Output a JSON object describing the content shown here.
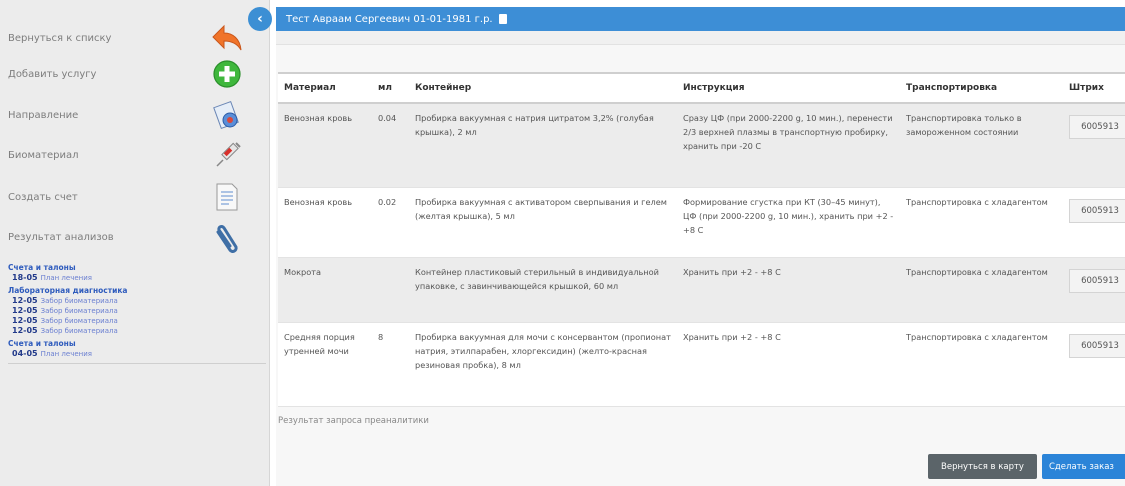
{
  "sidebar": {
    "items": [
      {
        "label": "Вернуться к списку",
        "icon": "back-arrow-icon"
      },
      {
        "label": "Добавить услугу",
        "icon": "add-plus-icon"
      },
      {
        "label": "Направление",
        "icon": "referral-icon"
      },
      {
        "label": "Биоматериал",
        "icon": "syringe-icon"
      },
      {
        "label": "Создать счет",
        "icon": "invoice-document-icon"
      },
      {
        "label": "Результат анализов",
        "icon": "paperclip-icon"
      }
    ],
    "collapse_icon": "chevron-left-icon",
    "links": [
      {
        "title": "Счета и талоны",
        "entries": [
          {
            "date": "18-05",
            "text": "План лечения"
          }
        ]
      },
      {
        "title": "Лабораторная диагностика",
        "entries": [
          {
            "date": "12-05",
            "text": "Забор биоматериала"
          },
          {
            "date": "12-05",
            "text": "Забор биоматериала"
          },
          {
            "date": "12-05",
            "text": "Забор биоматериала"
          },
          {
            "date": "12-05",
            "text": "Забор биоматериала"
          }
        ]
      },
      {
        "title": "Счета и талоны",
        "entries": [
          {
            "date": "04-05",
            "text": "План лечения"
          }
        ]
      }
    ]
  },
  "header": {
    "patient": "Тест Авраам Сергеевич 01-01-1981 г.р.",
    "clip_icon": "clipboard-icon"
  },
  "table": {
    "headers": [
      "Материал",
      "мл",
      "Контейнер",
      "Инструкция",
      "Транспортировка",
      "Штрих"
    ],
    "rows": [
      {
        "material": "Венозная кровь",
        "ml": "0.04",
        "container": "Пробирка вакуумная с натрия цитратом 3,2% (голубая крышка), 2 мл",
        "instruction": "Сразу ЦФ (при 2000-2200 g, 10 мин.), перенести 2/3 верхней плазмы в транспортную пробирку, хранить при -20 С",
        "transport": "Транспортировка только в замороженном состоянии",
        "barcode": "6005913"
      },
      {
        "material": "Венозная кровь",
        "ml": "0.02",
        "container": "Пробирка вакуумная с активатором сверпывания и гелем (желтая крышка), 5 мл",
        "instruction": "Формирование сгустка при КТ (30–45 минут), ЦФ (при 2000-2200 g, 10 мин.), хранить при +2 - +8 С",
        "transport": "Транспортировка с хладагентом",
        "barcode": "6005913"
      },
      {
        "material": "Мокрота",
        "ml": "",
        "container": "Контейнер пластиковый стерильный в индивидуальной упаковке, с завинчивающейся крышкой, 60 мл",
        "instruction": "Хранить при +2 - +8 С",
        "transport": "Транспортировка с хладагентом",
        "barcode": "6005913"
      },
      {
        "material": "Средняя порция утренней мочи",
        "ml": "8",
        "container": "Пробирка вакуумная для мочи с консервантом (пропионат натрия, этилпарабен, хлоргексидин) (желто-красная резиновая пробка), 8 мл",
        "instruction": "Хранить при +2 - +8 С",
        "transport": "Транспортировка с хладагентом",
        "barcode": "6005913"
      }
    ]
  },
  "result_text": "Результат запроса преаналитики",
  "buttons": {
    "back_to_card": "Вернуться в карту",
    "make_order": "Сделать заказ"
  },
  "colors": {
    "accent": "#3d8ed6",
    "button_dark": "#5b6469",
    "button_primary": "#2b84d8",
    "link_title": "#2e5bbd"
  }
}
